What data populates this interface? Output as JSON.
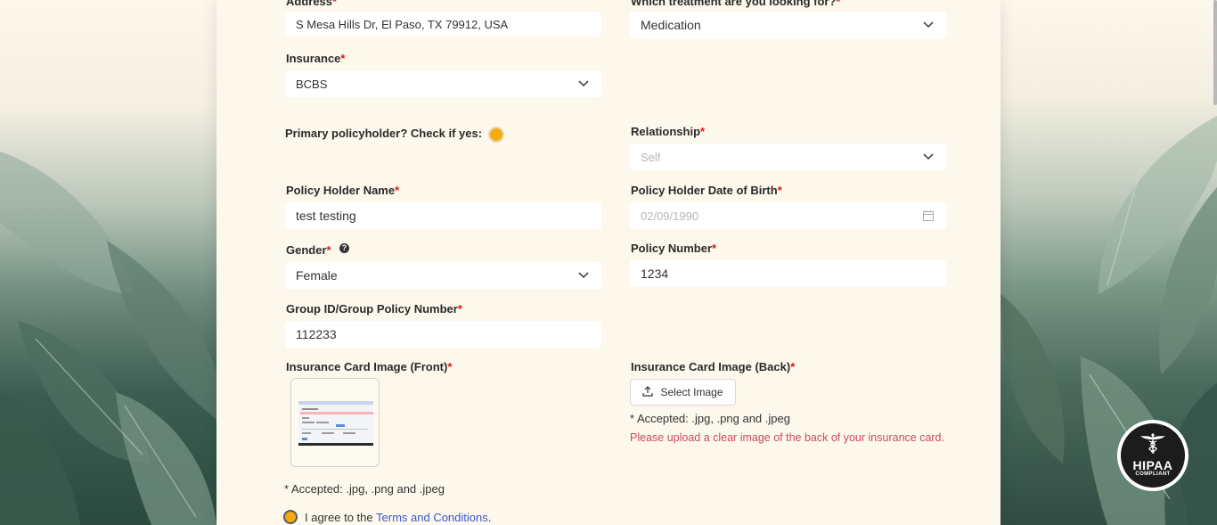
{
  "form": {
    "address": {
      "label": "Address",
      "required": "*",
      "value": "S Mesa Hills Dr, El Paso, TX 79912, USA"
    },
    "treatment": {
      "label": "Which treatment are you looking for?",
      "required": "*",
      "value": "Medication"
    },
    "insurance": {
      "label": "Insurance",
      "required": "*",
      "value": "BCBS"
    },
    "primary_policyholder": {
      "label": "Primary policyholder? Check if yes:"
    },
    "relationship": {
      "label": "Relationship",
      "required": "*",
      "placeholder": "Self"
    },
    "policy_holder_name": {
      "label": "Policy Holder Name",
      "required": "*",
      "value": "test testing"
    },
    "policy_holder_dob": {
      "label": "Policy Holder Date of Birth",
      "required": "*",
      "placeholder": "02/09/1990"
    },
    "gender": {
      "label": "Gender",
      "required": "*",
      "help": "?",
      "value": "Female"
    },
    "policy_number": {
      "label": "Policy Number",
      "required": "*",
      "value": "1234"
    },
    "group_id": {
      "label": "Group ID/Group Policy Number",
      "required": "*",
      "value": "112233"
    },
    "card_front": {
      "label": "Insurance Card Image (Front)",
      "required": "*",
      "accepted": "* Accepted: .jpg, .png and .jpeg"
    },
    "card_back": {
      "label": "Insurance Card Image (Back)",
      "required": "*",
      "button": "Select Image",
      "accepted": "* Accepted: .jpg, .png and .jpeg",
      "error": "Please upload a clear image of the back of your insurance card."
    },
    "terms": {
      "prefix": "I agree to the",
      "link": "Terms and Conditions",
      "suffix": "."
    }
  },
  "badge": {
    "title": "HIPAA",
    "subtitle": "COMPLIANT"
  },
  "icons": [
    "chevron-down-icon",
    "calendar-icon",
    "upload-icon",
    "help-icon",
    "caduceus-icon"
  ],
  "colors": {
    "accent": "#f6ac11",
    "required": "#d61a1a",
    "error": "#c94b5f",
    "link": "#3b56c7",
    "card_bg": "#fdf8ec"
  }
}
